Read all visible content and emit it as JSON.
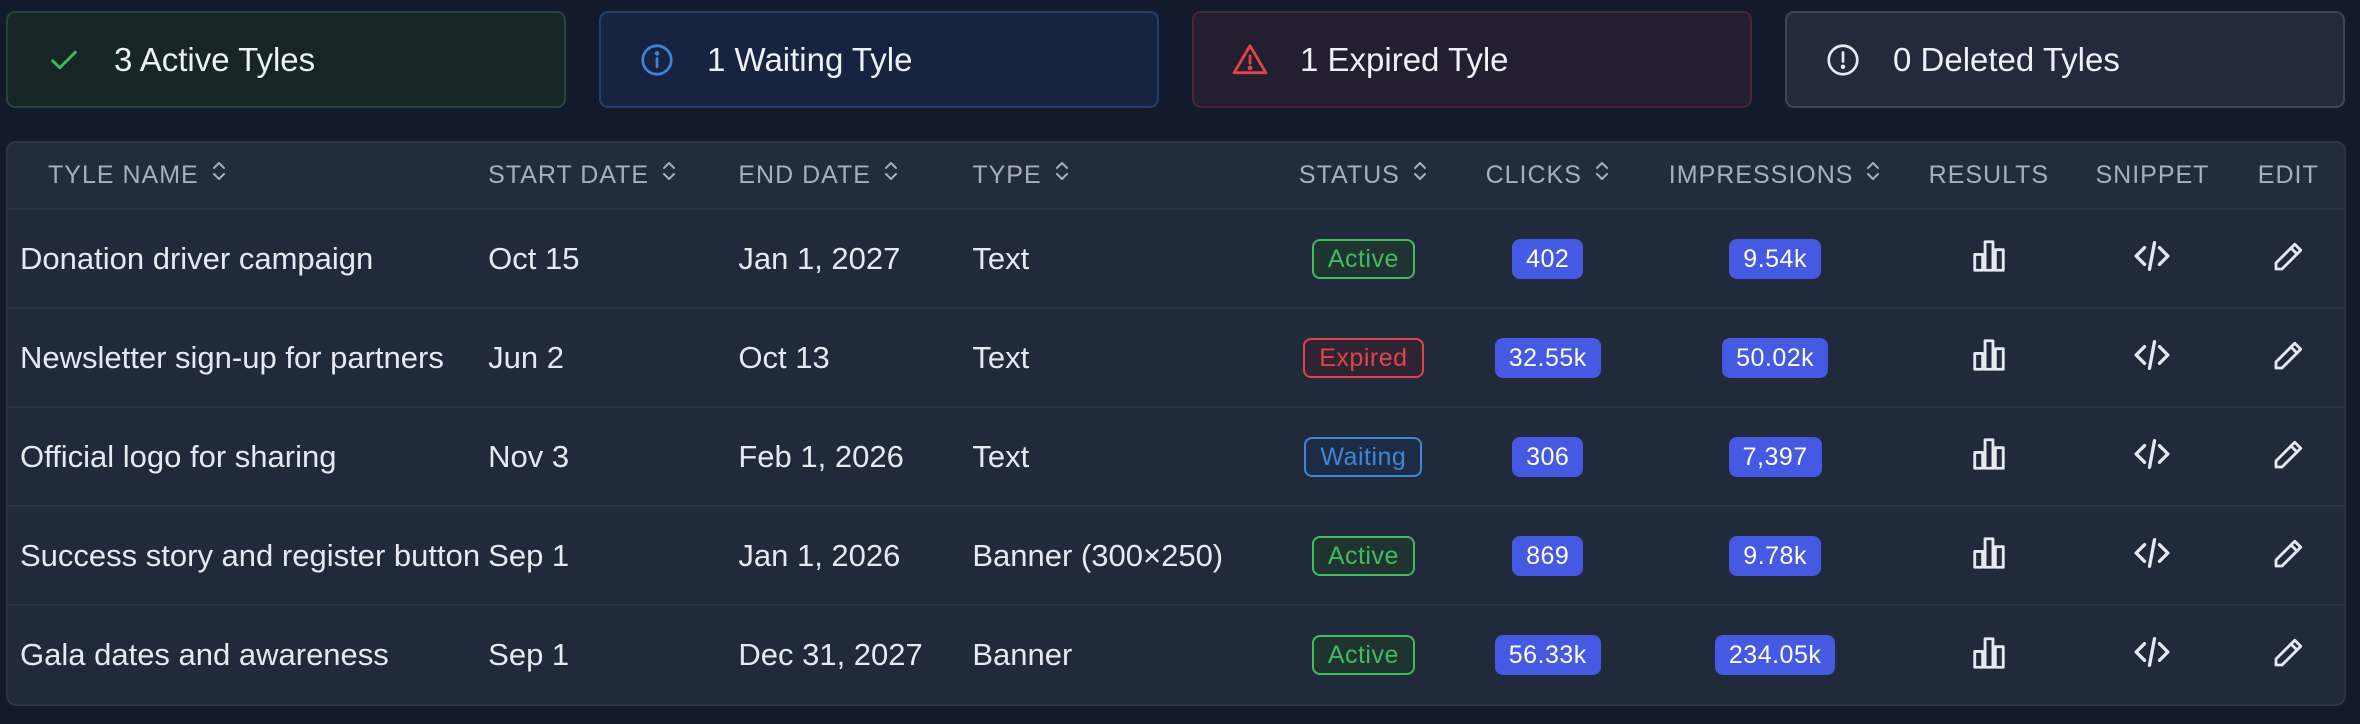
{
  "summary": {
    "active": "3 Active Tyles",
    "waiting": "1 Waiting Tyle",
    "expired": "1 Expired Tyle",
    "deleted": "0 Deleted Tyles"
  },
  "colors": {
    "active": "#3fbd5e",
    "waiting": "#3f86d8",
    "expired": "#e0434c",
    "deleted": "#e6e9ef",
    "pill": "#4659e3"
  },
  "columns": {
    "name": "TYLE NAME",
    "start": "START DATE",
    "end": "END DATE",
    "type": "TYPE",
    "status": "STATUS",
    "clicks": "CLICKS",
    "impressions": "IMPRESSIONS",
    "results": "RESULTS",
    "snippet": "SNIPPET",
    "edit": "EDIT"
  },
  "rows": [
    {
      "name": "Donation driver campaign",
      "start": "Oct 15",
      "end": "Jan 1, 2027",
      "type": "Text",
      "status": "Active",
      "clicks": "402",
      "impressions": "9.54k"
    },
    {
      "name": "Newsletter sign-up for partners",
      "start": "Jun 2",
      "end": "Oct 13",
      "type": "Text",
      "status": "Expired",
      "clicks": "32.55k",
      "impressions": "50.02k"
    },
    {
      "name": "Official logo for sharing",
      "start": "Nov 3",
      "end": "Feb 1, 2026",
      "type": "Text",
      "status": "Waiting",
      "clicks": "306",
      "impressions": "7,397"
    },
    {
      "name": "Success story and register button",
      "start": "Sep 1",
      "end": "Jan 1, 2026",
      "type": "Banner (300×250)",
      "status": "Active",
      "clicks": "869",
      "impressions": "9.78k"
    },
    {
      "name": "Gala dates and awareness",
      "start": "Sep 1",
      "end": "Dec 31, 2027",
      "type": "Banner",
      "status": "Active",
      "clicks": "56.33k",
      "impressions": "234.05k"
    }
  ],
  "icons": {
    "results": "bar-chart-icon",
    "snippet": "code-icon",
    "edit": "pencil-icon"
  }
}
